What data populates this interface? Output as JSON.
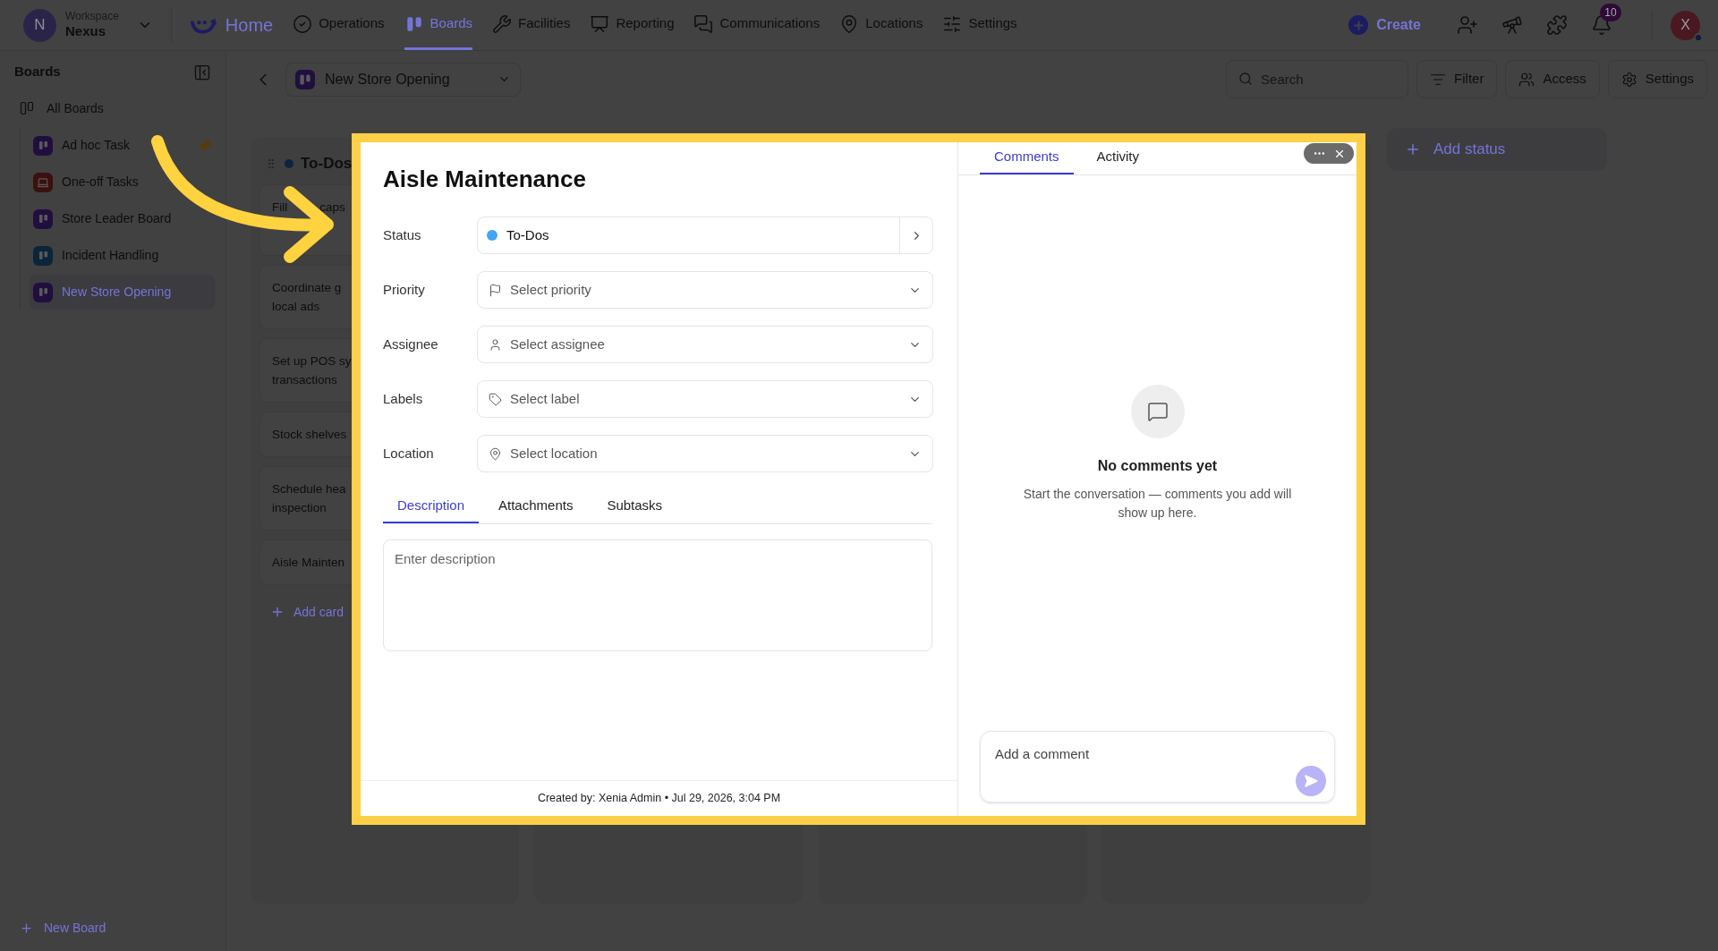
{
  "topbar": {
    "workspace": {
      "initial": "N",
      "label": "Workspace",
      "name": "Nexus"
    },
    "nav": [
      {
        "label": "Home",
        "kind": "brand",
        "selected": false
      },
      {
        "label": "Operations",
        "kind": "link",
        "selected": false
      },
      {
        "label": "Boards",
        "kind": "link",
        "selected": true
      },
      {
        "label": "Facilities",
        "kind": "link",
        "selected": false
      },
      {
        "label": "Reporting",
        "kind": "link",
        "selected": false
      },
      {
        "label": "Communications",
        "kind": "link",
        "selected": false
      },
      {
        "label": "Locations",
        "kind": "link",
        "selected": false
      },
      {
        "label": "Settings",
        "kind": "link",
        "selected": false
      }
    ],
    "create": "Create",
    "notification_count": "10",
    "avatar": "X"
  },
  "sidebar": {
    "title": "Boards",
    "all_boards": "All Boards",
    "boards": [
      {
        "name": "Ad hoc Task",
        "kind": "board",
        "color": "#200f3e",
        "pinned": true,
        "selected": false
      },
      {
        "name": "One-off Tasks",
        "kind": "laptop",
        "color": "#3a110f",
        "pinned": false,
        "selected": false
      },
      {
        "name": "Store Leader Board",
        "kind": "board",
        "color": "#200f3e",
        "pinned": false,
        "selected": false
      },
      {
        "name": "Incident Handling",
        "kind": "board",
        "color": "#0c2538",
        "pinned": false,
        "selected": false
      },
      {
        "name": "New Store Opening",
        "kind": "board",
        "color": "#200f3e",
        "pinned": false,
        "selected": true
      }
    ],
    "new_board": "New Board"
  },
  "board_header": {
    "board_name": "New Store Opening",
    "search": {
      "placeholder": "Search"
    },
    "buttons": [
      "Filter",
      "Access",
      "Settings"
    ]
  },
  "board": {
    "columns": [
      {
        "title": "To-Dos",
        "color": "#0f2240",
        "cards": [
          {
            "segments": [
              "Fill",
              "caps"
            ]
          },
          {
            "lines": [
              "Coordinate g",
              "local ads"
            ]
          },
          {
            "lines": [
              "Set up POS sy",
              "transactions"
            ]
          },
          {
            "lines": [
              "Stock shelves"
            ]
          },
          {
            "lines": [
              "Schedule hea",
              "inspection"
            ]
          },
          {
            "lines": [
              "Aisle Mainten"
            ]
          }
        ],
        "add_card": "Add card"
      }
    ],
    "add_status": "Add status"
  },
  "modal": {
    "title": "Aisle Maintenance",
    "fields": [
      {
        "label": "Status",
        "kind": "status",
        "value": "To-Dos",
        "color": "#42a5f5"
      },
      {
        "label": "Priority",
        "kind": "select",
        "placeholder": "Select priority"
      },
      {
        "label": "Assignee",
        "kind": "select",
        "placeholder": "Select assignee"
      },
      {
        "label": "Labels",
        "kind": "select",
        "placeholder": "Select label"
      },
      {
        "label": "Location",
        "kind": "select",
        "placeholder": "Select location"
      }
    ],
    "tabs": [
      {
        "label": "Description",
        "selected": true
      },
      {
        "label": "Attachments",
        "selected": false
      },
      {
        "label": "Subtasks",
        "selected": false
      }
    ],
    "description": {
      "placeholder": "Enter description"
    },
    "footer": "Created by: Xenia Admin • Jul 29, 2026, 3:04 PM",
    "side_tabs": [
      {
        "label": "Comments",
        "selected": true
      },
      {
        "label": "Activity",
        "selected": false
      }
    ],
    "empty_title": "No comments yet",
    "empty_text": "Start the conversation — comments you add will show up here.",
    "comment": {
      "placeholder": "Add a comment"
    }
  }
}
